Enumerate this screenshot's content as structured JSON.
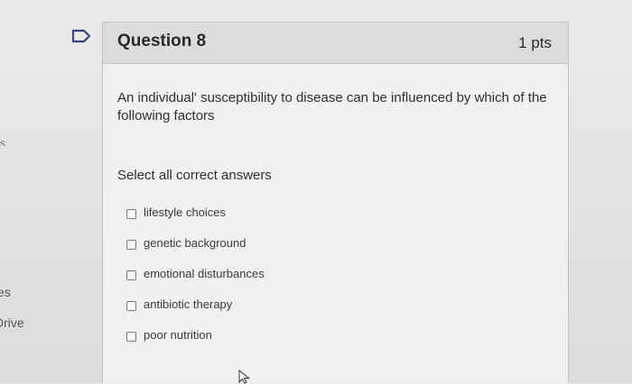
{
  "sidebar": {
    "fragments": [
      "es",
      "Drive"
    ]
  },
  "question": {
    "title": "Question 8",
    "points": "1 pts",
    "text": "An individual' susceptibility to disease can be influenced by which of the following factors",
    "instruction": "Select all correct answers"
  },
  "answers": [
    {
      "label": "lifestyle choices",
      "checked": false
    },
    {
      "label": "genetic background",
      "checked": false
    },
    {
      "label": "emotional disturbances",
      "checked": false
    },
    {
      "label": "antibiotic therapy",
      "checked": false
    },
    {
      "label": "poor nutrition",
      "checked": false
    }
  ],
  "icons": {
    "flag": "flag-icon",
    "cursor": "cursor-icon",
    "checkbox": "checkbox-icon"
  },
  "colors": {
    "header_bg": "#dcdcde",
    "card_bg": "#f1f1f1",
    "text": "#2f2f2f"
  }
}
